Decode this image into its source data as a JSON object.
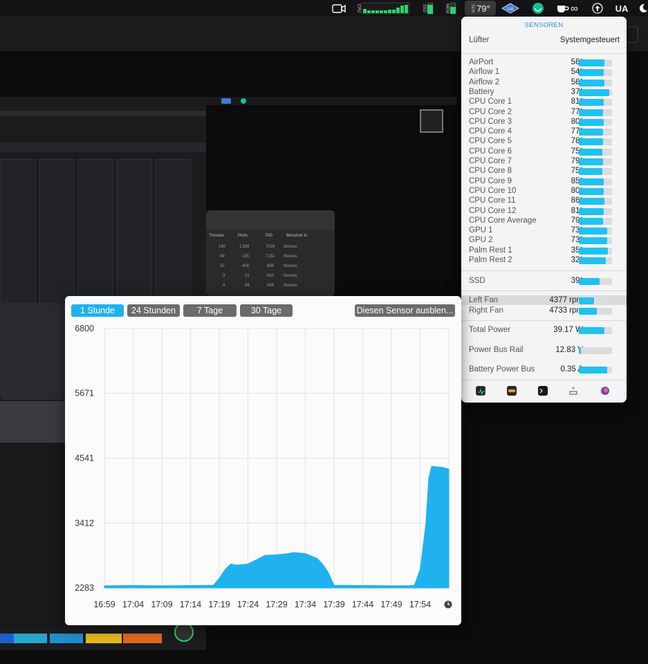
{
  "menubar": {
    "cpu_label": "CPU",
    "ssd_label": "SSD",
    "mem_label": "MEM",
    "sen_label": "SEN",
    "sen_temp": "79°",
    "ua_label": "UA",
    "infinity": "∞"
  },
  "popup": {
    "title": "SENSOREN",
    "fan_mode_label": "Lüfter",
    "fan_mode_value": "Systemgesteuert",
    "temps": [
      {
        "label": "AirPort",
        "value": "56°",
        "level": 0.78
      },
      {
        "label": "Airflow 1",
        "value": "54°",
        "level": 0.75
      },
      {
        "label": "Airflow 2",
        "value": "56°",
        "level": 0.78
      },
      {
        "label": "Battery",
        "value": "37°",
        "level": 0.92
      },
      {
        "label": "CPU Core 1",
        "value": "81°",
        "level": 0.74
      },
      {
        "label": "CPU Core 2",
        "value": "77°",
        "level": 0.72
      },
      {
        "label": "CPU Core 3",
        "value": "80°",
        "level": 0.74
      },
      {
        "label": "CPU Core 4",
        "value": "77°",
        "level": 0.72
      },
      {
        "label": "CPU Core 5",
        "value": "78°",
        "level": 0.72
      },
      {
        "label": "CPU Core 6",
        "value": "75°",
        "level": 0.7
      },
      {
        "label": "CPU Core 7",
        "value": "79°",
        "level": 0.73
      },
      {
        "label": "CPU Core 8",
        "value": "75°",
        "level": 0.7
      },
      {
        "label": "CPU Core 9",
        "value": "85°",
        "level": 0.76
      },
      {
        "label": "CPU Core 10",
        "value": "80°",
        "level": 0.74
      },
      {
        "label": "CPU Core 11",
        "value": "86°",
        "level": 0.77
      },
      {
        "label": "CPU Core 12",
        "value": "81°",
        "level": 0.74
      },
      {
        "label": "CPU Core Average",
        "value": "79°",
        "level": 0.73
      },
      {
        "label": "GPU 1",
        "value": "73°",
        "level": 0.85
      },
      {
        "label": "GPU 2",
        "value": "73°",
        "level": 0.85
      },
      {
        "label": "Palm Rest 1",
        "value": "35°",
        "level": 0.88
      },
      {
        "label": "Palm Rest 2",
        "value": "32°",
        "level": 0.82
      }
    ],
    "ssd": {
      "label": "SSD",
      "value": "39°",
      "level": 0.62
    },
    "fans": [
      {
        "label": "Left Fan",
        "value": "4377 rpm",
        "level": 0.45
      },
      {
        "label": "Right Fan",
        "value": "4733 rpm",
        "level": 0.55
      }
    ],
    "power": [
      {
        "label": "Total Power",
        "value": "39.17 W",
        "level": 0.78
      },
      {
        "label": "Power Bus Rail",
        "value": "12.83 V",
        "level": 0.06
      },
      {
        "label": "Battery Power Bus",
        "value": "0.35 A",
        "level": 0.85
      }
    ],
    "icons": [
      "activity-monitor-icon",
      "istat-icon",
      "terminal-icon",
      "thermal-icon",
      "app-icon"
    ]
  },
  "history": {
    "tabs": [
      "1 Stunde",
      "24 Stunden",
      "7 Tage",
      "30 Tage"
    ],
    "active_tab": 0,
    "hide_button": "Diesen Sensor ausblen..."
  },
  "chart_data": {
    "type": "area",
    "color": "#1fb2ee",
    "ylim": [
      2283,
      6800
    ],
    "yticks": [
      "6800",
      "5671",
      "4541",
      "3412",
      "2283"
    ],
    "xticks": [
      "16:59",
      "17:04",
      "17:09",
      "17:14",
      "17:19",
      "17:24",
      "17:29",
      "17:34",
      "17:39",
      "17:44",
      "17:49",
      "17:54"
    ],
    "x": [
      "16:59",
      "17:04",
      "17:09",
      "17:14",
      "17:18",
      "17:19",
      "17:20",
      "17:21",
      "17:22",
      "17:24",
      "17:26",
      "17:27",
      "17:29",
      "17:31",
      "17:32",
      "17:34",
      "17:36",
      "17:37",
      "17:38",
      "17:39",
      "17:44",
      "17:49",
      "17:52",
      "17:53",
      "17:54",
      "17:55",
      "17:55.5",
      "17:56",
      "17:58",
      "17:59"
    ],
    "values": [
      2320,
      2325,
      2320,
      2325,
      2330,
      2450,
      2600,
      2700,
      2680,
      2700,
      2800,
      2850,
      2860,
      2880,
      2900,
      2880,
      2800,
      2700,
      2550,
      2330,
      2325,
      2320,
      2320,
      2330,
      2600,
      3400,
      4200,
      4400,
      4380,
      4350
    ]
  }
}
